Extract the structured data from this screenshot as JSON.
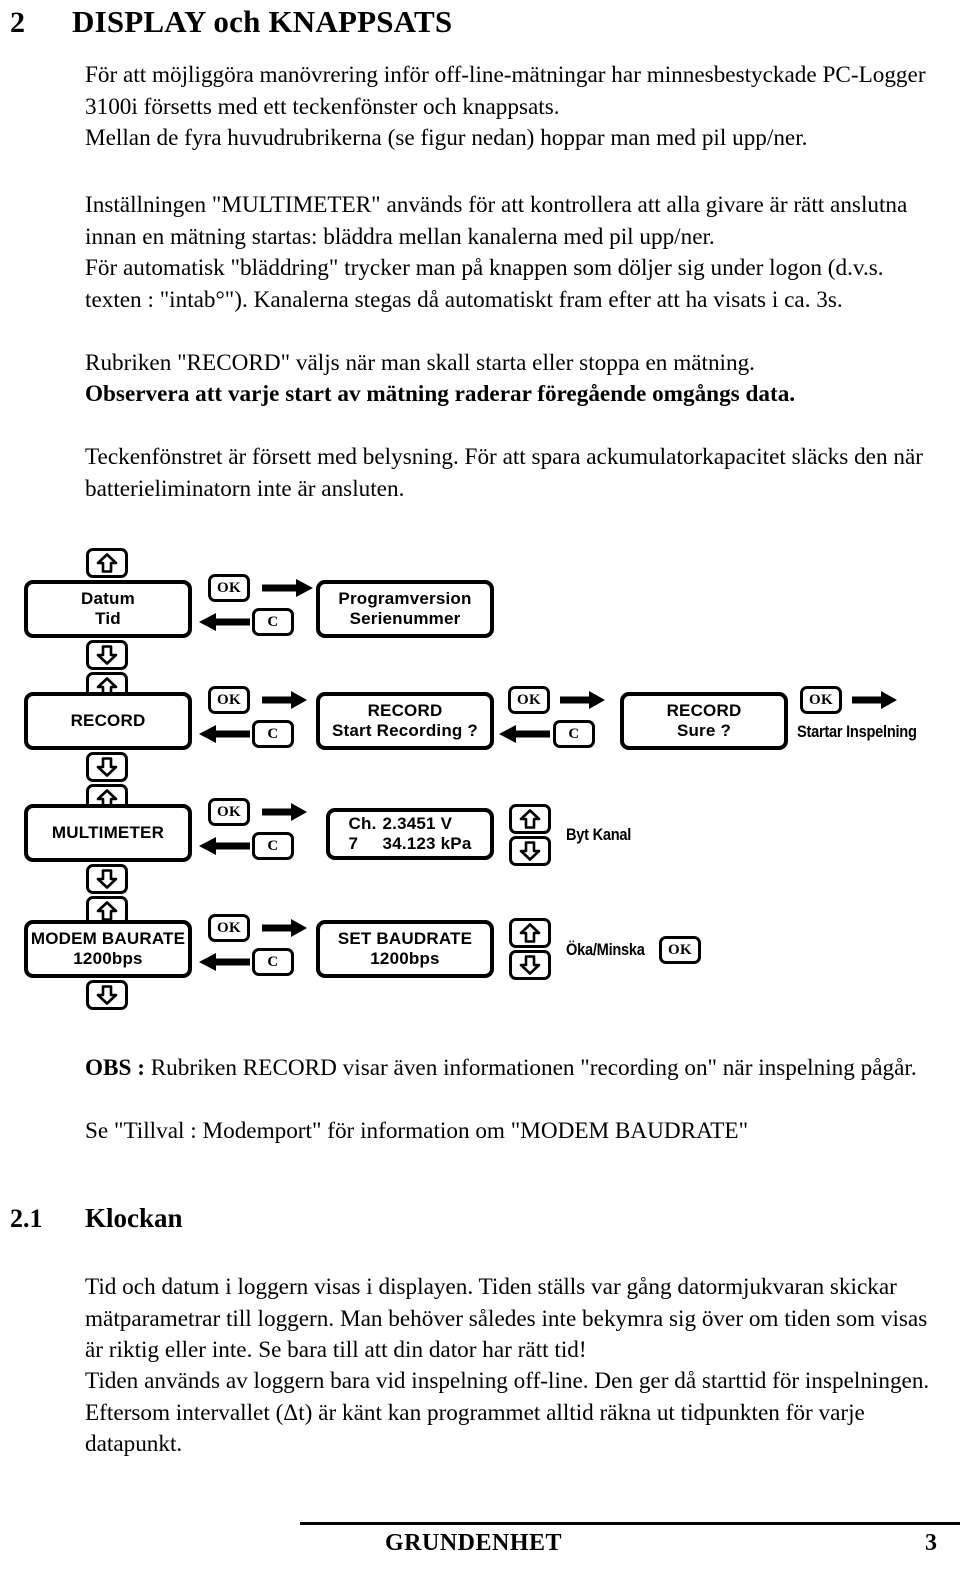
{
  "heading": {
    "number": "2",
    "title": "DISPLAY och KNAPPSATS"
  },
  "paragraphs": {
    "intro": "För att möjliggöra manövrering inför off-line-mätningar har minnesbestyckade PC-Logger 3100i försetts med ett teckenfönster och knappsats.",
    "intro2": "Mellan de fyra huvudrubrikerna (se figur nedan) hoppar man med pil upp/ner.",
    "multimeter_1": "Inställningen \"MULTIMETER\" används för att kontrollera att alla givare är rätt anslutna innan en mätning startas: bläddra mellan kanalerna med pil upp/ner.",
    "multimeter_2": "För automatisk \"bläddring\" trycker man på knappen som döljer sig under logon (d.v.s. texten : \"intab°\"). Kanalerna stegas då automatiskt fram efter att ha visats i ca. 3s.",
    "record_line": "Rubriken \"RECORD\" väljs när man skall starta eller stoppa en mätning.",
    "record_bold": "Observera att varje start av mätning raderar föregående omgångs data.",
    "backlight": "Teckenfönstret är försett med belysning. För att spara ackumulatorkapacitet släcks den när batterieliminatorn inte är ansluten.",
    "obs_label": "OBS :",
    "obs_text": " Rubriken RECORD visar även informationen \"recording on\" när inspelning pågår.",
    "obs_line2": "Se \"Tillval : Modemport\" för information om \"MODEM BAUDRATE\"",
    "klockan_1": "Tid och datum i loggern visas i displayen. Tiden ställs var gång datormjukvaran skickar mätparametrar till loggern. Man behöver således inte bekymra sig över om tiden som visas är riktig eller inte. Se bara till att din dator har rätt tid!",
    "klockan_2": "Tiden används av loggern bara vid inspelning off-line. Den ger då starttid för inspelningen. Eftersom intervallet (Δt) är känt kan programmet alltid räkna ut tidpunkten för varje datapunkt."
  },
  "subheading": {
    "number": "2.1",
    "title": "Klockan"
  },
  "diagram": {
    "keys": {
      "ok": "OK",
      "c": "C"
    },
    "rows": [
      {
        "menu": {
          "line1": "Datum",
          "line2": "Tid"
        },
        "detail": {
          "line1": "Programversion",
          "line2": "Serienummer"
        }
      },
      {
        "menu": {
          "line1": "RECORD",
          "line2": ""
        },
        "detail": {
          "line1": "RECORD",
          "line2": "Start Recording ?"
        },
        "detail2": {
          "line1": "RECORD",
          "line2": "Sure ?"
        },
        "end_label": "Startar Inspelning"
      },
      {
        "menu": {
          "line1": "MULTIMETER",
          "line2": ""
        },
        "detail_cols": {
          "col1_line1": "Ch.",
          "col1_line2": "7",
          "col2_line1": "2.3451 V",
          "col2_line2": "34.123 kPa"
        },
        "side_label": "Byt Kanal"
      },
      {
        "menu": {
          "line1": "MODEM BAURATE",
          "line2": "1200bps"
        },
        "detail": {
          "line1": "SET BAUDRATE",
          "line2": "1200bps"
        },
        "side_label": "Öka/Minska"
      }
    ]
  },
  "footer": {
    "label": "GRUNDENHET",
    "page": "3"
  }
}
